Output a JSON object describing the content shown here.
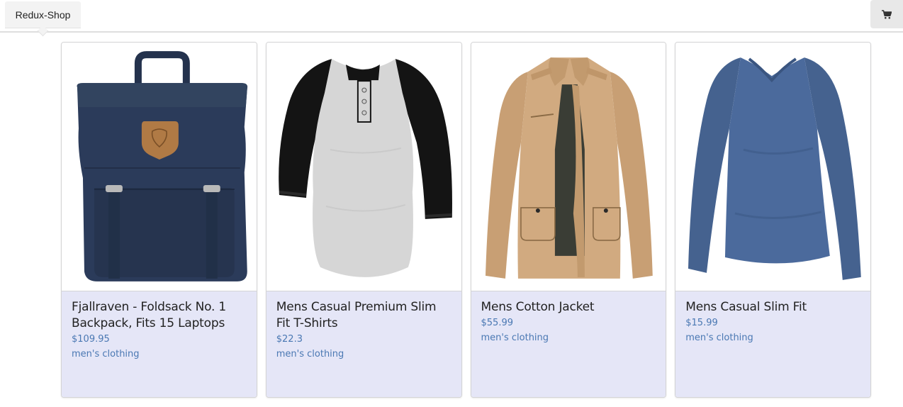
{
  "header": {
    "brand": "Redux-Shop",
    "cart_icon": "shopping-cart-icon"
  },
  "products": [
    {
      "title": "Fjallraven - Foldsack No. 1 Backpack, Fits 15 Laptops",
      "price": "$109.95",
      "category": "men's clothing",
      "image": "backpack-image"
    },
    {
      "title": "Mens Casual Premium Slim Fit T-Shirts",
      "price": "$22.3",
      "category": "men's clothing",
      "image": "raglan-tshirt-image"
    },
    {
      "title": "Mens Cotton Jacket",
      "price": "$55.99",
      "category": "men's clothing",
      "image": "cotton-jacket-image"
    },
    {
      "title": "Mens Casual Slim Fit",
      "price": "$15.99",
      "category": "men's clothing",
      "image": "slim-fit-shirt-image"
    }
  ],
  "colors": {
    "card_body_bg": "#e5e6f7",
    "accent_text": "#4a78b3",
    "backpack_navy": "#2b3b5a",
    "jacket_tan": "#d1aa80",
    "shirt_blue": "#4b6a9c"
  }
}
